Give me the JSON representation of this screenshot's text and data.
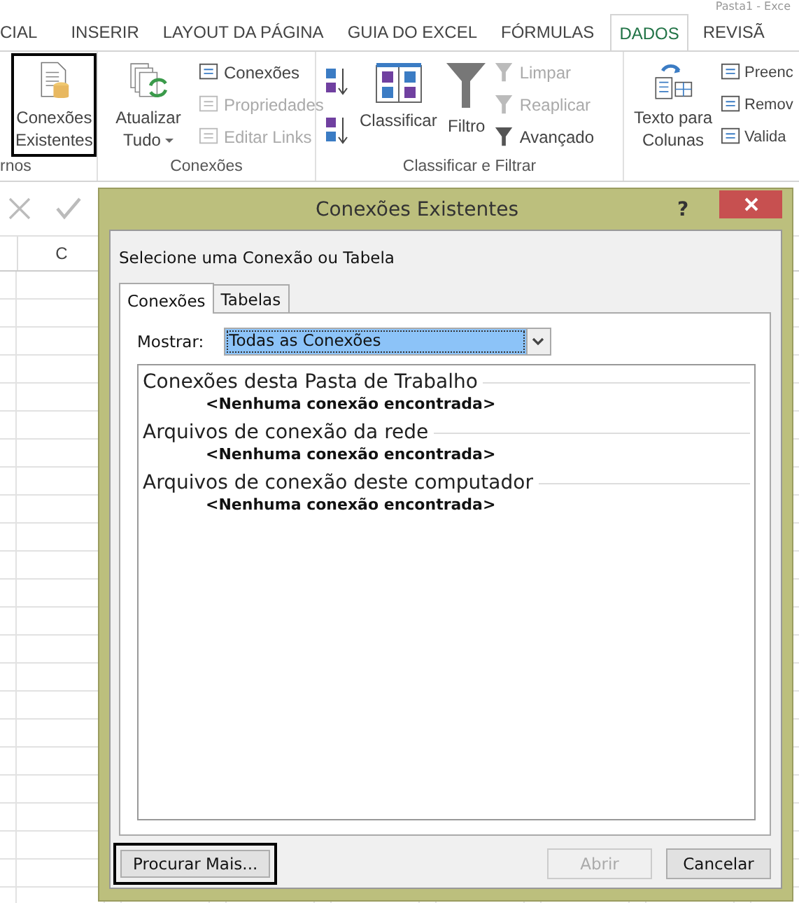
{
  "window": {
    "title_fragment": "Pasta1 - Exce"
  },
  "ribbon_tabs": [
    {
      "label": "CIAL",
      "selected": false
    },
    {
      "label": "INSERIR",
      "selected": false
    },
    {
      "label": "LAYOUT DA PÁGINA",
      "selected": false
    },
    {
      "label": "GUIA DO EXCEL",
      "selected": false
    },
    {
      "label": "FÓRMULAS",
      "selected": false
    },
    {
      "label": "DADOS",
      "selected": true
    },
    {
      "label": "REVISÃ",
      "selected": false
    }
  ],
  "ribbon_groups": [
    {
      "label": "rnos",
      "items": [
        {
          "kind": "large",
          "label": "Conexões Existentes",
          "disabled": false,
          "highlighted": true
        }
      ]
    },
    {
      "label": "Conexões",
      "items": [
        {
          "kind": "large",
          "label": "Atualizar Tudo",
          "disabled": false,
          "highlighted": false
        },
        {
          "kind": "small",
          "label": "Conexões",
          "disabled": false
        },
        {
          "kind": "small",
          "label": "Propriedades",
          "disabled": true
        },
        {
          "kind": "small",
          "label": "Editar Links",
          "disabled": true
        }
      ]
    },
    {
      "label": "Classificar e Filtrar",
      "items": [
        {
          "kind": "sortpair"
        },
        {
          "kind": "large",
          "label": "Classificar",
          "disabled": false,
          "highlighted": false
        },
        {
          "kind": "large",
          "label": "Filtro",
          "disabled": false,
          "highlighted": false
        },
        {
          "kind": "small",
          "label": "Limpar",
          "disabled": true
        },
        {
          "kind": "small",
          "label": "Reaplicar",
          "disabled": true
        },
        {
          "kind": "small",
          "label": "Avançado",
          "disabled": false
        }
      ]
    },
    {
      "items": [
        {
          "kind": "large",
          "label": "Texto para Colunas",
          "disabled": false,
          "highlighted": false
        },
        {
          "kind": "small",
          "label": "Preenc",
          "disabled": false
        },
        {
          "kind": "small",
          "label": "Remov",
          "disabled": false
        },
        {
          "kind": "small",
          "label": "Valida",
          "disabled": false
        }
      ]
    }
  ],
  "column_header": "C",
  "dialog": {
    "title": "Conexões Existentes",
    "help": "?",
    "prompt": "Selecione uma Conexão ou Tabela",
    "tabs": [
      {
        "label": "Conexões",
        "selected": true
      },
      {
        "label": "Tabelas",
        "selected": false
      }
    ],
    "show_label": "Mostrar:",
    "show_value": "Todas as Conexões",
    "sections": [
      {
        "heading": "Conexões desta Pasta de Trabalho",
        "empty": "<Nenhuma conexão encontrada>"
      },
      {
        "heading": "Arquivos de conexão da rede",
        "empty": "<Nenhuma conexão encontrada>"
      },
      {
        "heading": "Arquivos de conexão deste computador",
        "empty": "<Nenhuma conexão encontrada>"
      }
    ],
    "buttons": [
      {
        "label": "Procurar Mais...",
        "disabled": false,
        "highlighted": true,
        "kind": "left"
      },
      {
        "label": "Abrir",
        "disabled": true,
        "highlighted": false,
        "kind": "right"
      },
      {
        "label": "Cancelar",
        "disabled": false,
        "highlighted": false,
        "kind": "right"
      }
    ]
  }
}
